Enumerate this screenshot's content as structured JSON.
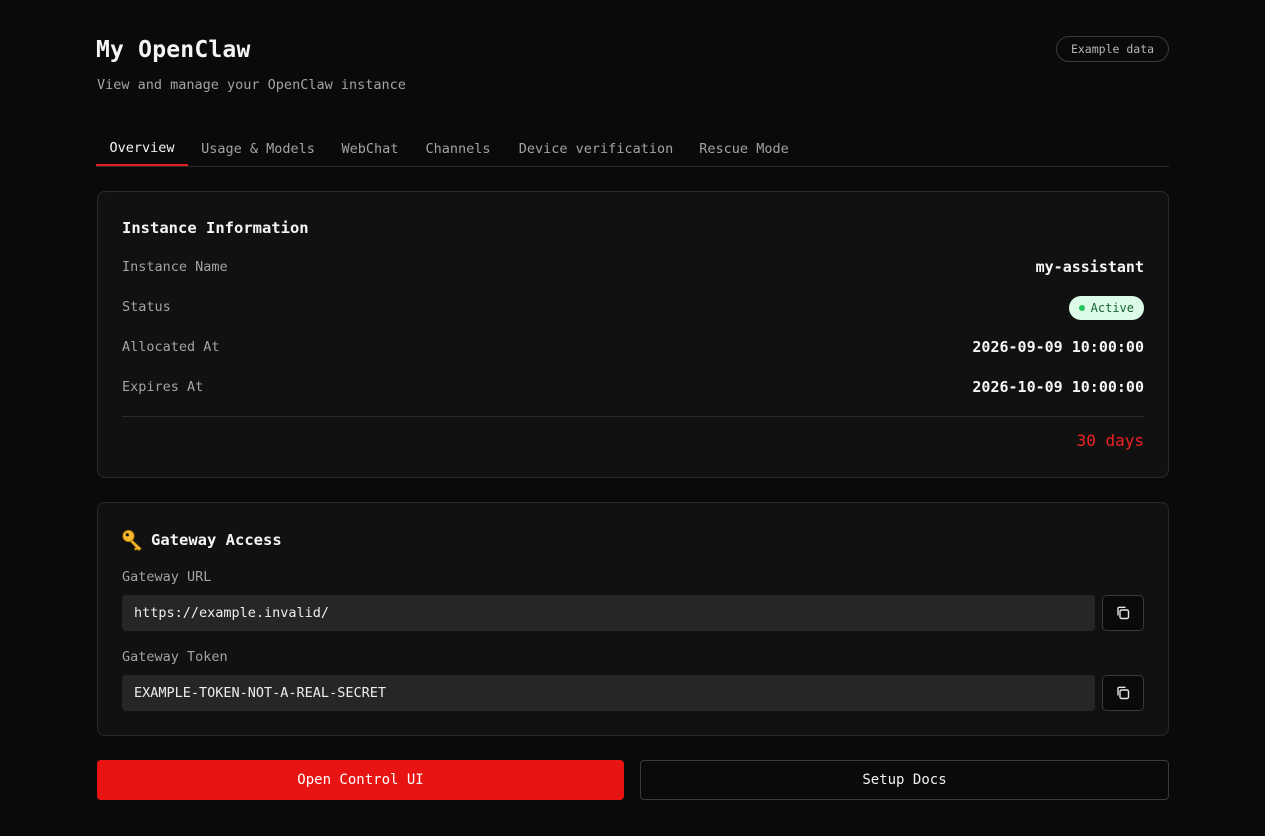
{
  "header": {
    "title": "My OpenClaw",
    "subtitle": "View and manage your OpenClaw instance",
    "badge": "Example data"
  },
  "tabs": [
    {
      "label": "Overview",
      "active": true
    },
    {
      "label": "Usage & Models",
      "active": false
    },
    {
      "label": "WebChat",
      "active": false
    },
    {
      "label": "Channels",
      "active": false
    },
    {
      "label": "Device verification",
      "active": false
    },
    {
      "label": "Rescue Mode",
      "active": false
    }
  ],
  "instance": {
    "title": "Instance Information",
    "name_label": "Instance Name",
    "name_value": "my-assistant",
    "status_label": "Status",
    "status_value": "Active",
    "allocated_label": "Allocated At",
    "allocated_value": "2026-09-09 10:00:00",
    "expires_label": "Expires At",
    "expires_value": "2026-10-09 10:00:00",
    "remaining": "30 days"
  },
  "gateway": {
    "icon": "key-icon",
    "title": "Gateway Access",
    "url_label": "Gateway URL",
    "url_value": "https://example.invalid/",
    "token_label": "Gateway Token",
    "token_value": "EXAMPLE-TOKEN-NOT-A-REAL-SECRET"
  },
  "actions": {
    "primary_label": "Open Control UI",
    "secondary_label": "Setup Docs"
  },
  "colors": {
    "accent": "#e81414",
    "status_bg": "#dcfce7",
    "status_text": "#166534",
    "remaining_text": "#ef2323"
  }
}
